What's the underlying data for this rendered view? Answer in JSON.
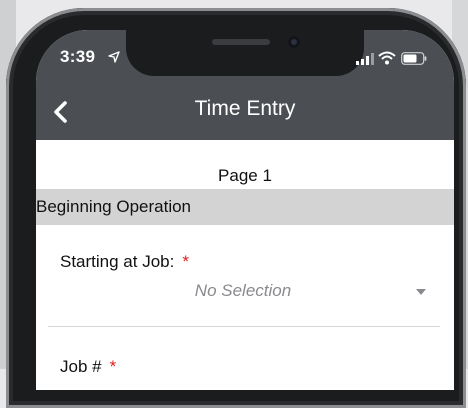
{
  "status_bar": {
    "time": "3:39"
  },
  "nav": {
    "title": "Time Entry"
  },
  "page": {
    "label": "Page 1"
  },
  "section": {
    "title": "Beginning Operation"
  },
  "fields": {
    "starting_job": {
      "label": "Starting at Job:",
      "required_mark": "*",
      "value": "No Selection"
    },
    "job_number": {
      "label": "Job #",
      "required_mark": "*"
    }
  },
  "colors": {
    "header": "#4b4f54",
    "section_bg": "#d3d3d4",
    "required": "#e0191b",
    "placeholder": "#8a8a8e"
  },
  "icons": [
    "location-arrow-icon",
    "signal-icon",
    "wifi-icon",
    "battery-icon",
    "back-chevron-icon",
    "dropdown-caret-icon"
  ]
}
